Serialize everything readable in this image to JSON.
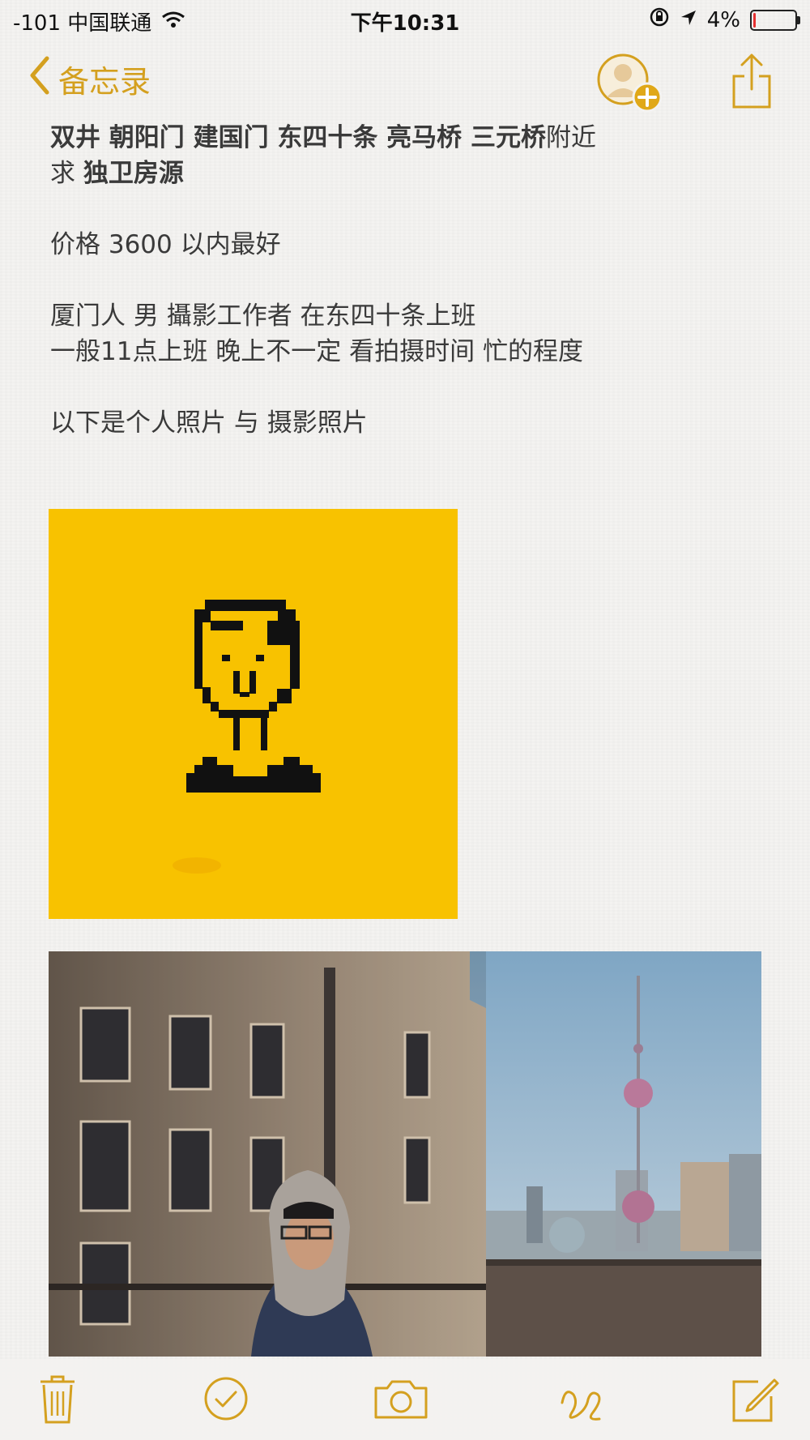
{
  "status_bar": {
    "carrier": "-101 中国联通",
    "time": "下午10:31",
    "battery_percent": "4%",
    "battery_level": 0.04
  },
  "nav": {
    "back_label": "备忘录"
  },
  "note": {
    "line1_segments": [
      {
        "text": "双井 朝阳门 建国门 东四十条 亮马桥 三元桥",
        "bold": true
      },
      {
        "text": "附近",
        "bold": false
      }
    ],
    "line2_prefix": "求 ",
    "line2_bold": "独卫房源",
    "price_prefix": "价格 ",
    "price_value": "3600",
    "price_suffix": " 以内最好",
    "intro_line1": "厦门人 男 攝影工作者 在东四十条上班",
    "intro_line2": "一般11点上班 晚上不一定 看拍摄时间 忙的程度",
    "photos_heading": "以下是个人照片 与 摄影照片"
  },
  "icons": {
    "back": "chevron-left-icon",
    "contact_add": "add-contact-icon",
    "share": "share-icon",
    "trash": "trash-icon",
    "checklist": "checklist-icon",
    "camera": "camera-icon",
    "sketch": "sketch-icon",
    "compose": "compose-icon"
  },
  "colors": {
    "accent": "#d4a01f",
    "avatar_background": "#f8c200",
    "background": "#f4f3f1"
  }
}
